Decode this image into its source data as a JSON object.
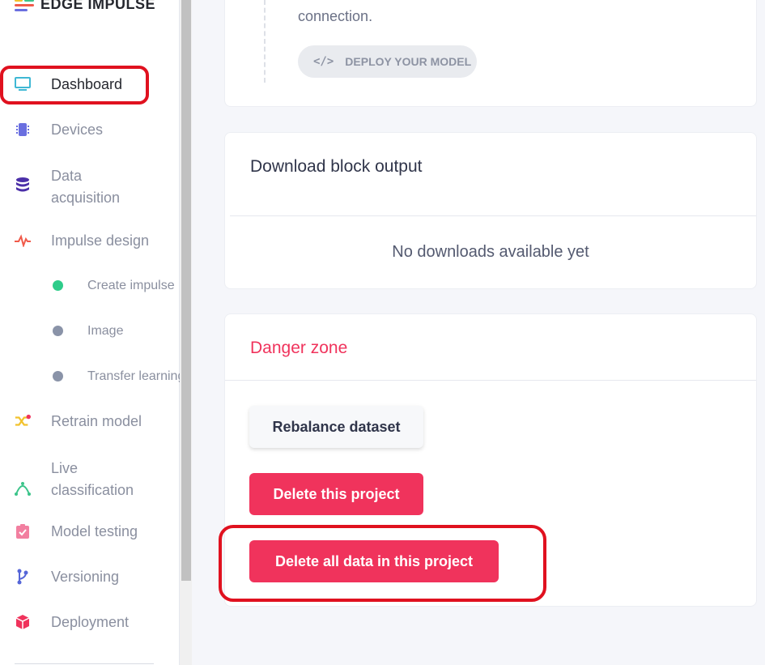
{
  "brand": {
    "name": "EDGE IMPULSE"
  },
  "sidebar": {
    "items": [
      {
        "label": "Dashboard",
        "icon": "monitor-icon",
        "color": "#3fb8d4"
      },
      {
        "label": "Devices",
        "icon": "chip-icon",
        "color": "#6a6fe0"
      },
      {
        "label": "Data\nacquisition",
        "icon": "database-icon",
        "color": "#4b2fa8"
      },
      {
        "label": "Impulse design",
        "icon": "pulse-icon",
        "color": "#f05a4a"
      },
      {
        "label": "Retrain model",
        "icon": "shuffle-icon",
        "color": "#f2c22e"
      },
      {
        "label": "Live\nclassification",
        "icon": "bezier-icon",
        "color": "#3cc48a"
      },
      {
        "label": "Model testing",
        "icon": "clipboard-check-icon",
        "color": "#f27fa0"
      },
      {
        "label": "Versioning",
        "icon": "branch-icon",
        "color": "#5566d8"
      },
      {
        "label": "Deployment",
        "icon": "cube-icon",
        "color": "#f0335c"
      }
    ],
    "sub_items": [
      {
        "label": "Create impulse",
        "dot_color": "#2ecc8a"
      },
      {
        "label": "Image",
        "dot_color": "#8a93a8"
      },
      {
        "label": "Transfer learning",
        "dot_color": "#8a93a8"
      }
    ]
  },
  "top_card": {
    "text": "connection.",
    "deploy_button": "DEPLOY YOUR MODEL"
  },
  "download_card": {
    "title": "Download block output",
    "empty_text": "No downloads available yet"
  },
  "danger_card": {
    "title": "Danger zone",
    "rebalance_button": "Rebalance dataset",
    "delete_project_button": "Delete this project",
    "delete_data_button": "Delete all data in this project"
  },
  "colors": {
    "danger": "#f0335c",
    "annotation": "#e0111f"
  }
}
